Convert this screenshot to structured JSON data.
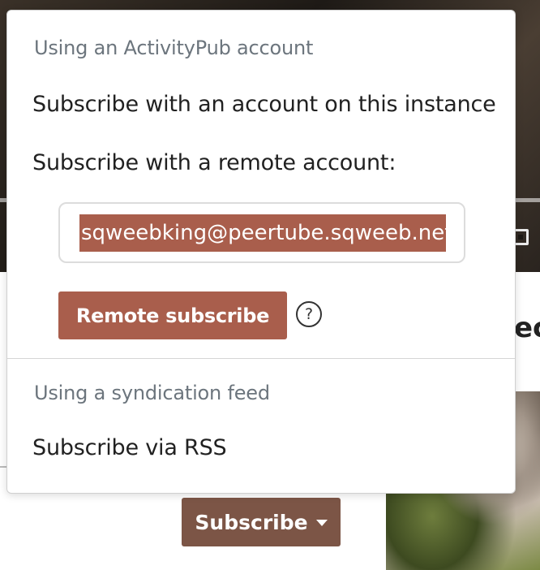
{
  "dropdown": {
    "activitypub_header": "Using an ActivityPub account",
    "local_subscribe_label": "Subscribe with an account on this instance",
    "remote_subscribe_prompt": "Subscribe with a remote account:",
    "remote_account_value": "sqweebking@peertube.sqweeb.net",
    "remote_subscribe_button": "Remote subscribe",
    "help_icon_glyph": "?",
    "syndication_header": "Using a syndication feed",
    "rss_label": "Subscribe via RSS"
  },
  "subscribe_button": {
    "label": "Subscribe"
  },
  "background": {
    "title_fragment": "ec"
  },
  "colors": {
    "accent": "#a95e4c",
    "subscribe_button": "#7c5546",
    "section_header": "#6c757d"
  },
  "icons": {
    "help": "question-circle-icon",
    "caret": "caret-down-icon",
    "fullscreen": "fullscreen-icon"
  }
}
